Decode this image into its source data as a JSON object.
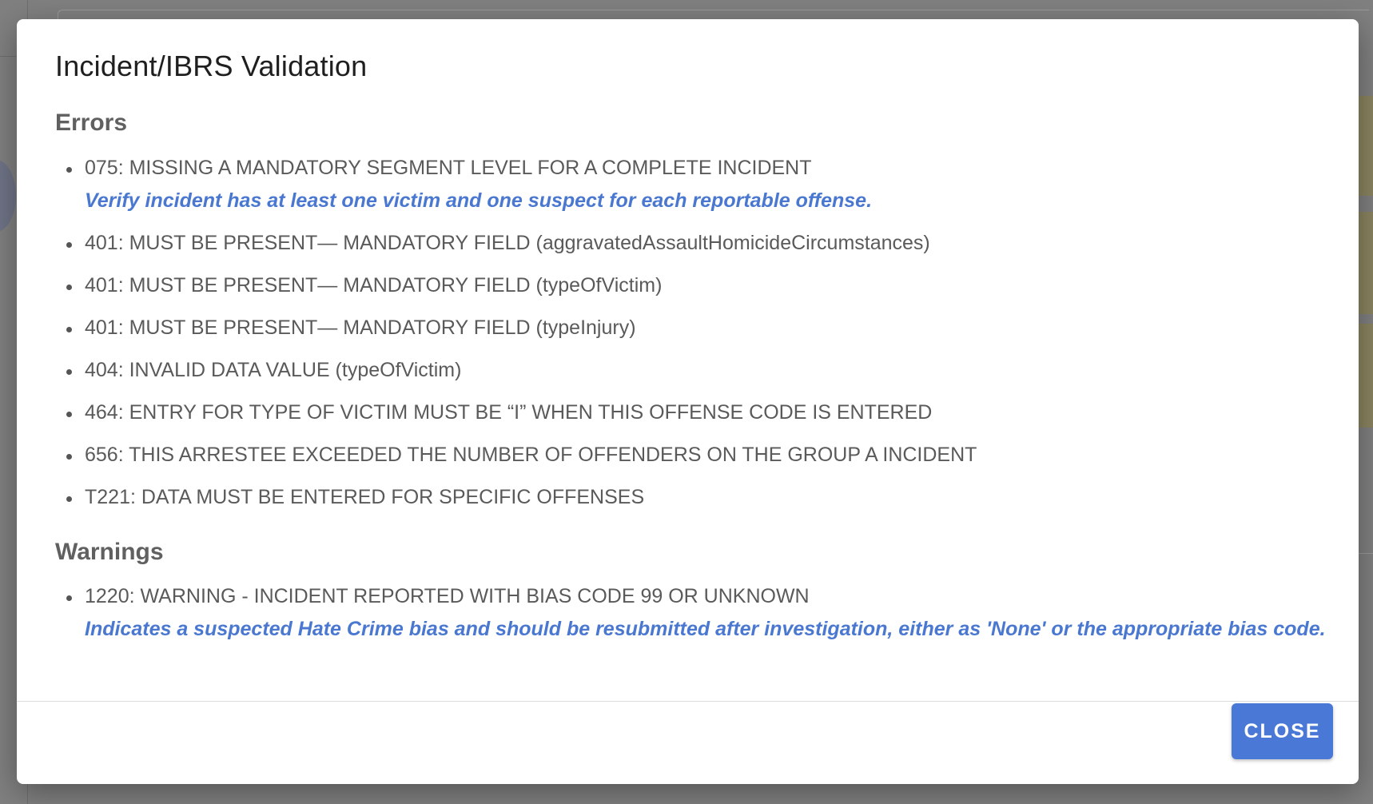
{
  "dialog": {
    "title": "Incident/IBRS Validation",
    "close_label": "CLOSE"
  },
  "errors": {
    "heading": "Errors",
    "items": [
      {
        "text": "075: MISSING A MANDATORY SEGMENT LEVEL FOR A COMPLETE INCIDENT",
        "hint": "Verify incident has at least one victim and one suspect for each reportable offense."
      },
      {
        "text": "401: MUST BE PRESENT— MANDATORY FIELD (aggravatedAssaultHomicideCircumstances)"
      },
      {
        "text": "401: MUST BE PRESENT— MANDATORY FIELD (typeOfVictim)"
      },
      {
        "text": "401: MUST BE PRESENT— MANDATORY FIELD (typeInjury)"
      },
      {
        "text": "404: INVALID DATA VALUE (typeOfVictim)"
      },
      {
        "text": "464: ENTRY FOR TYPE OF VICTIM MUST BE “I” WHEN THIS OFFENSE CODE IS ENTERED"
      },
      {
        "text": "656: THIS ARRESTEE EXCEEDED THE NUMBER OF OFFENDERS ON THE GROUP A INCIDENT"
      },
      {
        "text": "T221: DATA MUST BE ENTERED FOR SPECIFIC OFFENSES"
      }
    ]
  },
  "warnings": {
    "heading": "Warnings",
    "items": [
      {
        "text": "1220: WARNING - INCIDENT REPORTED WITH BIAS CODE 99 OR UNKNOWN",
        "hint": "Indicates a suspected Hate Crime bias and should be resubmitted after investigation, either as 'None' or the appropriate bias code."
      }
    ]
  },
  "colors": {
    "overlay": "#808080",
    "dialog_background": "#ffffff",
    "hint_text": "#4a78d0",
    "primary_button": "#4a78d6"
  }
}
